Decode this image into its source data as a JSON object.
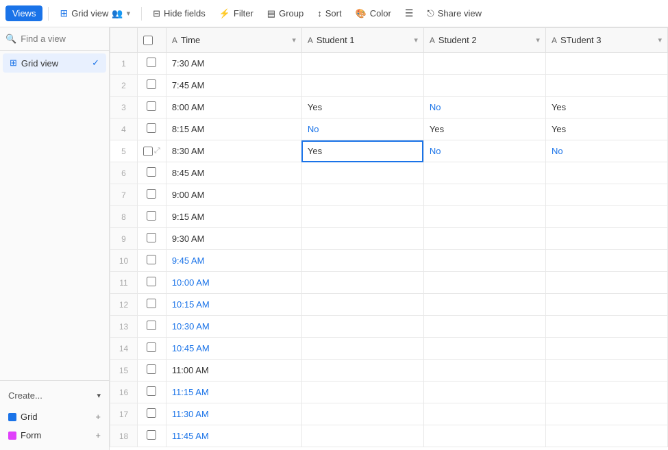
{
  "toolbar": {
    "views_label": "Views",
    "grid_view_label": "Grid view",
    "hide_fields_label": "Hide fields",
    "filter_label": "Filter",
    "group_label": "Group",
    "sort_label": "Sort",
    "color_label": "Color",
    "share_view_label": "Share view"
  },
  "sidebar": {
    "search_placeholder": "Find a view",
    "grid_view_label": "Grid view",
    "create_label": "Create...",
    "grid_label": "Grid",
    "form_label": "Form"
  },
  "table": {
    "columns": [
      {
        "id": "time",
        "label": "Time",
        "type": "text",
        "icon": "A"
      },
      {
        "id": "student1",
        "label": "Student 1",
        "type": "text",
        "icon": "A"
      },
      {
        "id": "student2",
        "label": "Student 2",
        "type": "text",
        "icon": "A"
      },
      {
        "id": "student3",
        "label": "STudent 3",
        "type": "text",
        "icon": "A"
      }
    ],
    "rows": [
      {
        "num": 1,
        "time": "7:30 AM",
        "s1": "",
        "s2": "",
        "s3": "",
        "time_blue": false
      },
      {
        "num": 2,
        "time": "7:45 AM",
        "s1": "",
        "s2": "",
        "s3": "",
        "time_blue": false
      },
      {
        "num": 3,
        "time": "8:00 AM",
        "s1": "Yes",
        "s2": "No",
        "s3": "Yes",
        "time_blue": false
      },
      {
        "num": 4,
        "time": "8:15 AM",
        "s1": "No",
        "s2": "Yes",
        "s3": "Yes",
        "time_blue": false
      },
      {
        "num": 5,
        "time": "8:30 AM",
        "s1": "Yes",
        "s2": "No",
        "s3": "No",
        "time_blue": false,
        "active": true
      },
      {
        "num": 6,
        "time": "8:45 AM",
        "s1": "",
        "s2": "",
        "s3": "",
        "time_blue": false
      },
      {
        "num": 7,
        "time": "9:00 AM",
        "s1": "",
        "s2": "",
        "s3": "",
        "time_blue": false
      },
      {
        "num": 8,
        "time": "9:15 AM",
        "s1": "",
        "s2": "",
        "s3": "",
        "time_blue": false
      },
      {
        "num": 9,
        "time": "9:30 AM",
        "s1": "",
        "s2": "",
        "s3": "",
        "time_blue": false
      },
      {
        "num": 10,
        "time": "9:45 AM",
        "s1": "",
        "s2": "",
        "s3": "",
        "time_blue": true
      },
      {
        "num": 11,
        "time": "10:00 AM",
        "s1": "",
        "s2": "",
        "s3": "",
        "time_blue": true
      },
      {
        "num": 12,
        "time": "10:15 AM",
        "s1": "",
        "s2": "",
        "s3": "",
        "time_blue": true
      },
      {
        "num": 13,
        "time": "10:30 AM",
        "s1": "",
        "s2": "",
        "s3": "",
        "time_blue": true
      },
      {
        "num": 14,
        "time": "10:45 AM",
        "s1": "",
        "s2": "",
        "s3": "",
        "time_blue": true
      },
      {
        "num": 15,
        "time": "11:00 AM",
        "s1": "",
        "s2": "",
        "s3": "",
        "time_blue": false
      },
      {
        "num": 16,
        "time": "11:15 AM",
        "s1": "",
        "s2": "",
        "s3": "",
        "time_blue": true
      },
      {
        "num": 17,
        "time": "11:30 AM",
        "s1": "",
        "s2": "",
        "s3": "",
        "time_blue": true
      },
      {
        "num": 18,
        "time": "11:45 AM",
        "s1": "",
        "s2": "",
        "s3": "",
        "time_blue": true
      }
    ]
  }
}
